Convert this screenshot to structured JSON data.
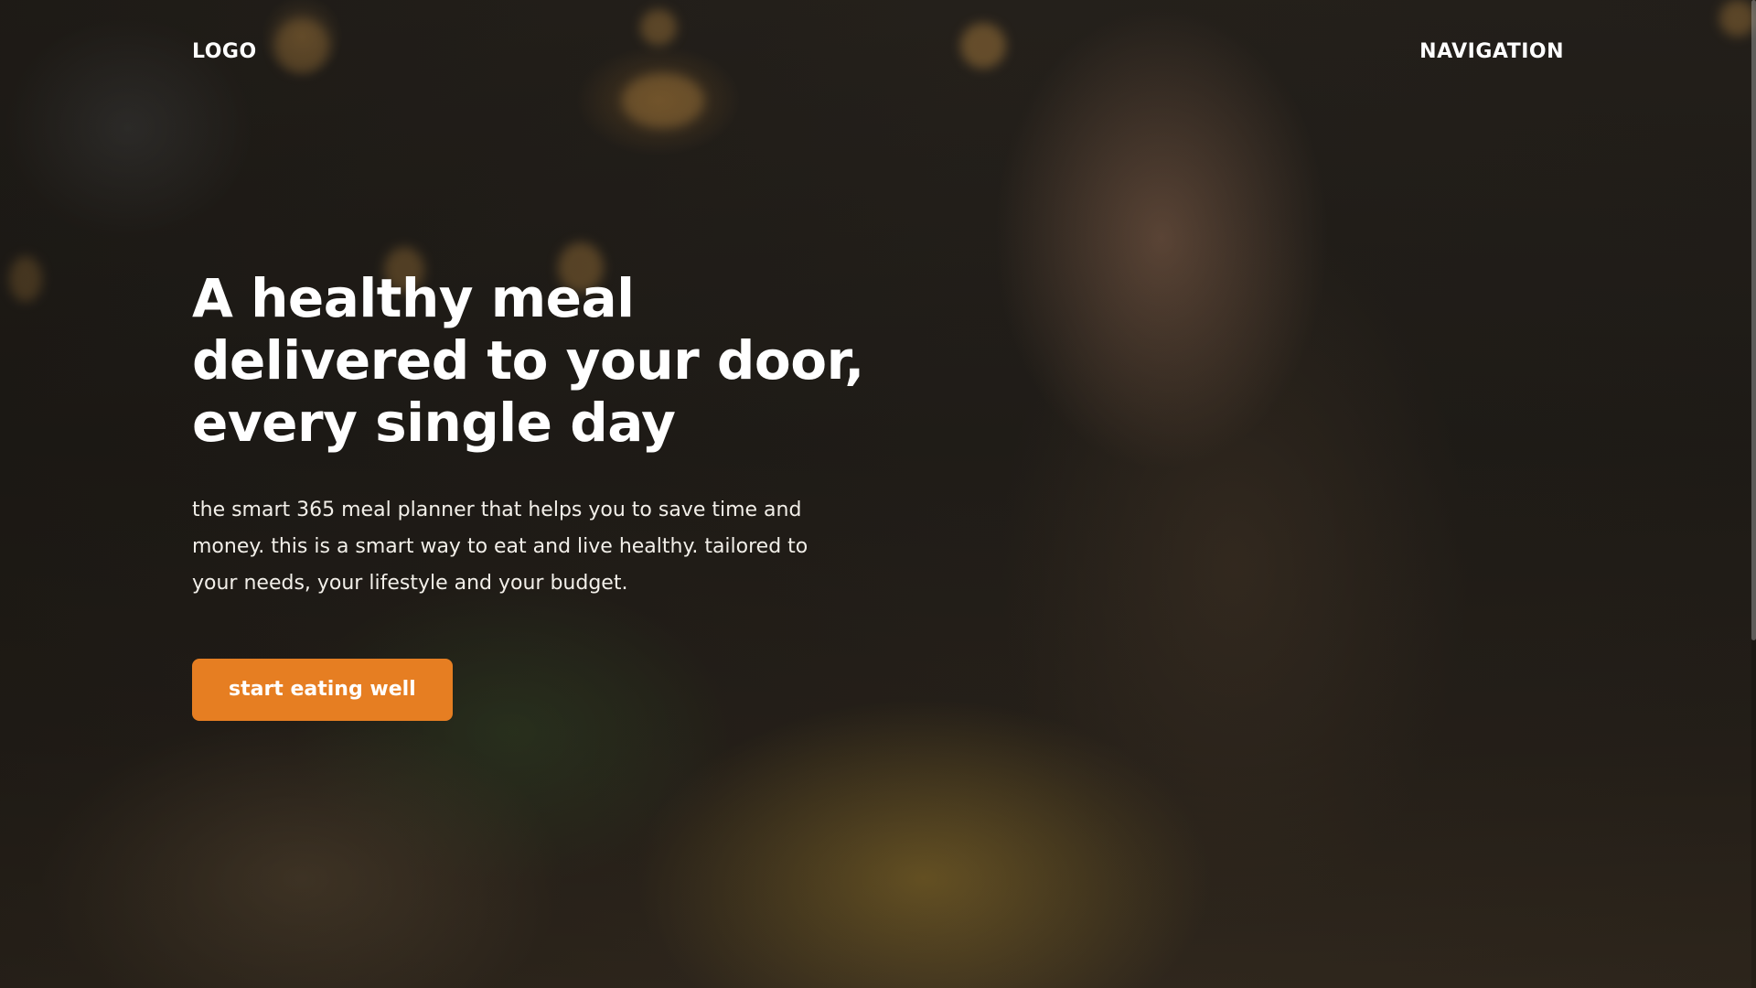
{
  "header": {
    "logo": "LOGO",
    "navigation": "NAVIGATION"
  },
  "hero": {
    "headline": [
      "A healthy meal",
      "delivered to your door,",
      "every single day"
    ],
    "description": "the smart 365 meal planner that helps you to save time and money. this is a smart way to eat and live healthy. tailored to your needs, your lifestyle and your budget.",
    "cta_label": "start eating well",
    "cta_color": "#e67e22"
  }
}
